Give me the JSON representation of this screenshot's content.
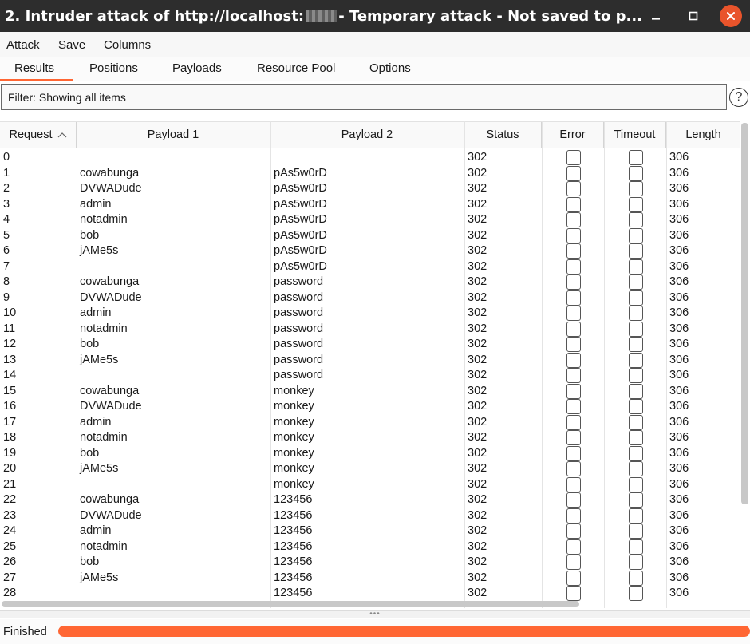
{
  "window": {
    "title_prefix": "2. Intruder attack of http://localhost:",
    "title_suffix": " - Temporary attack - Not saved to p...",
    "close_color": "#e9542b"
  },
  "menu": {
    "attack": "Attack",
    "save": "Save",
    "columns": "Columns"
  },
  "tabs": [
    {
      "label": "Results",
      "active": true
    },
    {
      "label": "Positions",
      "active": false
    },
    {
      "label": "Payloads",
      "active": false
    },
    {
      "label": "Resource Pool",
      "active": false
    },
    {
      "label": "Options",
      "active": false
    }
  ],
  "filter": {
    "text": "Filter: Showing all items",
    "help_icon": "question-circle-icon"
  },
  "table": {
    "columns": {
      "request": "Request",
      "payload1": "Payload 1",
      "payload2": "Payload 2",
      "status": "Status",
      "error": "Error",
      "timeout": "Timeout",
      "length": "Length"
    },
    "sort_indicator": "sort-ascending-icon",
    "rows": [
      {
        "request": "0",
        "payload1": "",
        "payload2": "",
        "status": "302",
        "length": "306"
      },
      {
        "request": "1",
        "payload1": "cowabunga",
        "payload2": "pAs5w0rD",
        "status": "302",
        "length": "306"
      },
      {
        "request": "2",
        "payload1": "DVWADude",
        "payload2": "pAs5w0rD",
        "status": "302",
        "length": "306"
      },
      {
        "request": "3",
        "payload1": "admin",
        "payload2": "pAs5w0rD",
        "status": "302",
        "length": "306"
      },
      {
        "request": "4",
        "payload1": "notadmin",
        "payload2": "pAs5w0rD",
        "status": "302",
        "length": "306"
      },
      {
        "request": "5",
        "payload1": "bob",
        "payload2": "pAs5w0rD",
        "status": "302",
        "length": "306"
      },
      {
        "request": "6",
        "payload1": "jAMe5s",
        "payload2": "pAs5w0rD",
        "status": "302",
        "length": "306"
      },
      {
        "request": "7",
        "payload1": "",
        "payload2": "pAs5w0rD",
        "status": "302",
        "length": "306"
      },
      {
        "request": "8",
        "payload1": "cowabunga",
        "payload2": "password",
        "status": "302",
        "length": "306"
      },
      {
        "request": "9",
        "payload1": "DVWADude",
        "payload2": "password",
        "status": "302",
        "length": "306"
      },
      {
        "request": "10",
        "payload1": "admin",
        "payload2": "password",
        "status": "302",
        "length": "306"
      },
      {
        "request": "11",
        "payload1": "notadmin",
        "payload2": "password",
        "status": "302",
        "length": "306"
      },
      {
        "request": "12",
        "payload1": "bob",
        "payload2": "password",
        "status": "302",
        "length": "306"
      },
      {
        "request": "13",
        "payload1": "jAMe5s",
        "payload2": "password",
        "status": "302",
        "length": "306"
      },
      {
        "request": "14",
        "payload1": "",
        "payload2": "password",
        "status": "302",
        "length": "306"
      },
      {
        "request": "15",
        "payload1": "cowabunga",
        "payload2": "monkey",
        "status": "302",
        "length": "306"
      },
      {
        "request": "16",
        "payload1": "DVWADude",
        "payload2": "monkey",
        "status": "302",
        "length": "306"
      },
      {
        "request": "17",
        "payload1": "admin",
        "payload2": "monkey",
        "status": "302",
        "length": "306"
      },
      {
        "request": "18",
        "payload1": "notadmin",
        "payload2": "monkey",
        "status": "302",
        "length": "306"
      },
      {
        "request": "19",
        "payload1": "bob",
        "payload2": "monkey",
        "status": "302",
        "length": "306"
      },
      {
        "request": "20",
        "payload1": "jAMe5s",
        "payload2": "monkey",
        "status": "302",
        "length": "306"
      },
      {
        "request": "21",
        "payload1": "",
        "payload2": "monkey",
        "status": "302",
        "length": "306"
      },
      {
        "request": "22",
        "payload1": "cowabunga",
        "payload2": "123456",
        "status": "302",
        "length": "306"
      },
      {
        "request": "23",
        "payload1": "DVWADude",
        "payload2": "123456",
        "status": "302",
        "length": "306"
      },
      {
        "request": "24",
        "payload1": "admin",
        "payload2": "123456",
        "status": "302",
        "length": "306"
      },
      {
        "request": "25",
        "payload1": "notadmin",
        "payload2": "123456",
        "status": "302",
        "length": "306"
      },
      {
        "request": "26",
        "payload1": "bob",
        "payload2": "123456",
        "status": "302",
        "length": "306"
      },
      {
        "request": "27",
        "payload1": "jAMe5s",
        "payload2": "123456",
        "status": "302",
        "length": "306"
      },
      {
        "request": "28",
        "payload1": "",
        "payload2": "123456",
        "status": "302",
        "length": "306"
      }
    ]
  },
  "status": {
    "label": "Finished",
    "progress": 1.0,
    "progress_color": "#ff6633"
  }
}
